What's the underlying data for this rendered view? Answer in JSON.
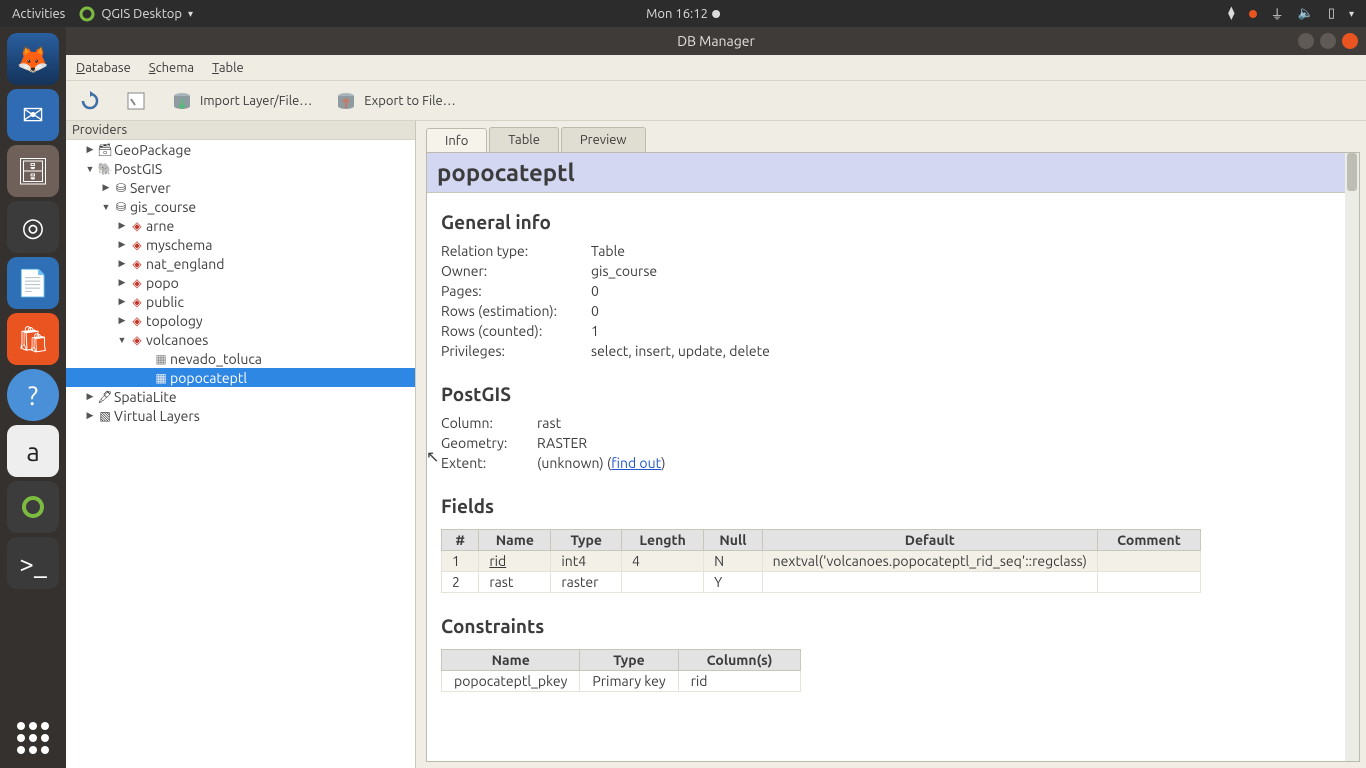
{
  "ubuntu": {
    "activities": "Activities",
    "app_name": "QGIS Desktop",
    "clock": "Mon 16:12"
  },
  "window": {
    "title": "DB Manager"
  },
  "menu": {
    "database": "Database",
    "schema": "Schema",
    "table": "Table"
  },
  "toolbar": {
    "import": "Import Layer/File…",
    "export": "Export to File…"
  },
  "sidebar": {
    "title": "Providers",
    "items": {
      "geopackage": "GeoPackage",
      "postgis": "PostGIS",
      "server": "Server",
      "gis_course": "gis_course",
      "arne": "arne",
      "myschema": "myschema",
      "nat_england": "nat_england",
      "popo": "popo",
      "public": "public",
      "topology": "topology",
      "volcanoes": "volcanoes",
      "nevado": "nevado_toluca",
      "popoca": "popocateptl",
      "spatialite": "SpatiaLite",
      "virtual": "Virtual Layers"
    }
  },
  "tabs": {
    "info": "Info",
    "table": "Table",
    "preview": "Preview"
  },
  "page": {
    "title": "popocateptl",
    "general_heading": "General info",
    "general": [
      {
        "k": "Relation type:",
        "v": "Table"
      },
      {
        "k": "Owner:",
        "v": "gis_course"
      },
      {
        "k": "Pages:",
        "v": "0"
      },
      {
        "k": "Rows (estimation):",
        "v": "0"
      },
      {
        "k": "Rows (counted):",
        "v": "1"
      },
      {
        "k": "Privileges:",
        "v": "select, insert, update, delete"
      }
    ],
    "postgis_heading": "PostGIS",
    "postgis": {
      "column_k": "Column:",
      "column_v": "rast",
      "geom_k": "Geometry:",
      "geom_v": "RASTER",
      "extent_k": "Extent:",
      "extent_v1": "(unknown) (",
      "extent_link": "find out",
      "extent_v2": ")"
    },
    "fields_heading": "Fields",
    "fields_headers": {
      "num": "#",
      "name": "Name",
      "type": "Type",
      "length": "Length",
      "null": "Null",
      "default": "Default",
      "comment": "Comment"
    },
    "fields_rows": [
      {
        "num": "1",
        "name": "rid",
        "type": "int4",
        "length": "4",
        "null": "N",
        "default": "nextval('volcanoes.popocateptl_rid_seq'::regclass)",
        "comment": ""
      },
      {
        "num": "2",
        "name": "rast",
        "type": "raster",
        "length": "",
        "null": "Y",
        "default": "",
        "comment": ""
      }
    ],
    "constraints_heading": "Constraints",
    "constraints_headers": {
      "name": "Name",
      "type": "Type",
      "cols": "Column(s)"
    },
    "constraints_rows": [
      {
        "name": "popocateptl_pkey",
        "type": "Primary key",
        "cols": "rid"
      }
    ]
  }
}
